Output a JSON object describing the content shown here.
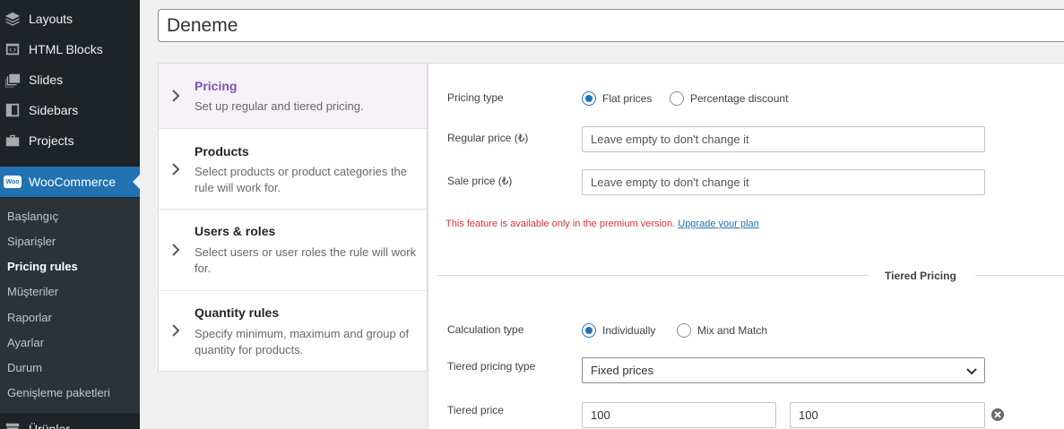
{
  "sidebar": {
    "items": [
      {
        "label": "Layouts",
        "icon": "layers-icon"
      },
      {
        "label": "HTML Blocks",
        "icon": "code-block-icon"
      },
      {
        "label": "Slides",
        "icon": "slides-icon"
      },
      {
        "label": "Sidebars",
        "icon": "sidebar-icon"
      },
      {
        "label": "Projects",
        "icon": "briefcase-icon"
      }
    ],
    "woocommerce": {
      "label": "WooCommerce",
      "icon": "woocommerce-icon",
      "icon_text": "Woo"
    },
    "submenu": [
      {
        "label": "Başlangıç"
      },
      {
        "label": "Siparişler"
      },
      {
        "label": "Pricing rules"
      },
      {
        "label": "Müşteriler"
      },
      {
        "label": "Raporlar"
      },
      {
        "label": "Ayarlar"
      },
      {
        "label": "Durum"
      },
      {
        "label": "Genişleme paketleri"
      }
    ],
    "bottom_item": {
      "label": "Ürünler",
      "icon": "archive-icon"
    }
  },
  "rule_title": "Deneme",
  "tabs": [
    {
      "title": "Pricing",
      "desc": "Set up regular and tiered pricing."
    },
    {
      "title": "Products",
      "desc": "Select products or product categories the rule will work for."
    },
    {
      "title": "Users & roles",
      "desc": "Select users or user roles the rule will work for."
    },
    {
      "title": "Quantity rules",
      "desc": "Specify minimum, maximum and group of quantity for products."
    }
  ],
  "pricing": {
    "pricing_type_label": "Pricing type",
    "pricing_type_options": [
      "Flat prices",
      "Percentage discount"
    ],
    "regular_price_label": "Regular price (₺)",
    "regular_price_placeholder": "Leave empty to don't change it",
    "sale_price_label": "Sale price (₺)",
    "sale_price_placeholder": "Leave empty to don't change it",
    "notice_text": "This feature is available only in the premium version.",
    "notice_link": "Upgrade your plan"
  },
  "tiered": {
    "section_title": "Tiered Pricing",
    "calc_type_label": "Calculation type",
    "calc_type_options": [
      "Individually",
      "Mix and Match"
    ],
    "tiered_type_label": "Tiered pricing type",
    "tiered_type_value": "Fixed prices",
    "tiered_price_label": "Tiered price",
    "tier_quantity": "100",
    "tier_price": "100"
  },
  "colors": {
    "sidebar_bg": "#1d2327",
    "submenu_bg": "#2c3338",
    "accent_blue": "#2271b1",
    "active_tab_purple": "#7f54b3",
    "notice_red": "#d63638"
  }
}
